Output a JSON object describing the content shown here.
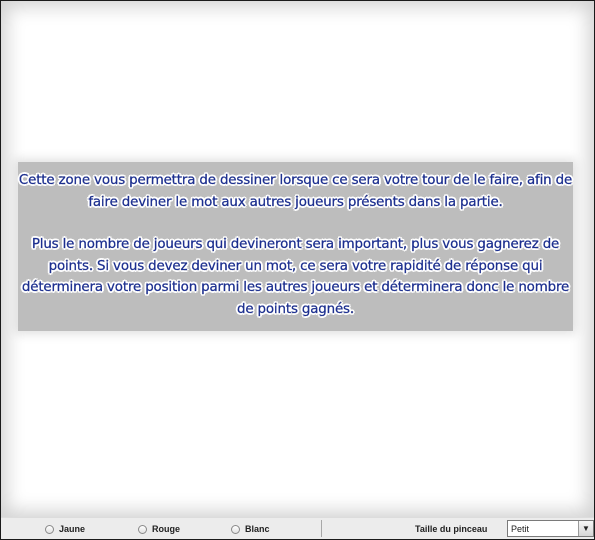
{
  "tutorial": {
    "paragraph1": "Cette zone vous permettra de dessiner lorsque ce sera votre tour de le faire, afin de faire deviner le mot aux autres joueurs présents dans la partie.",
    "paragraph2": "Plus le nombre de joueurs qui devineront sera important, plus vous gagnerez de points. Si vous devez deviner un mot, ce sera votre rapidité de réponse qui déterminera votre position parmi les autres joueurs et déterminera donc le nombre de points gagnés."
  },
  "toolbar": {
    "colors": [
      {
        "label": "Jaune"
      },
      {
        "label": "Rouge"
      },
      {
        "label": "Blanc"
      }
    ],
    "brush_size_label": "Taille du pinceau",
    "brush_size_value": "Petit"
  }
}
